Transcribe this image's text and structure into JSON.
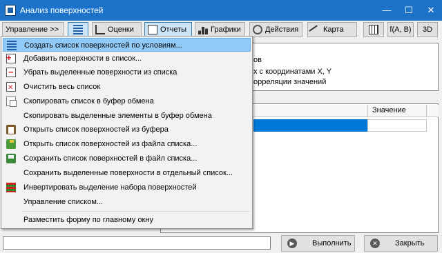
{
  "window": {
    "title": "Анализ поверхностей",
    "minimize": "—",
    "maximize": "☐",
    "close": "✕"
  },
  "toolbar": {
    "manage": "Управление >>",
    "grades": "Оценки",
    "reports": "Отчеты",
    "charts": "Графики",
    "actions": "Действия",
    "map": "Карта",
    "func": "f(A, B)",
    "three_d": "3D"
  },
  "info_panel": {
    "line1": "ов",
    "line2": "х с координатами X, Y",
    "line3": "орреляции значений"
  },
  "grid": {
    "value_header": "Значение"
  },
  "menu": {
    "items": [
      {
        "label": "Создать список поверхностей по условиям...",
        "icon": "list-conditions-icon"
      },
      {
        "label": "Добавить поверхности в список...",
        "icon": "add-to-list-icon"
      },
      {
        "label": "Убрать выделенные поверхности из списка",
        "icon": "remove-from-list-icon"
      },
      {
        "label": "Очистить весь список",
        "icon": "clear-list-icon"
      },
      {
        "label": "Скопировать список в буфер обмена",
        "icon": "copy-icon"
      },
      {
        "label": "Скопировать выделенные элементы в буфер обмена",
        "icon": ""
      },
      {
        "label": "Открыть список поверхностей из буфера",
        "icon": "clipboard-icon"
      },
      {
        "label": "Открыть список поверхностей из файла списка...",
        "icon": "open-file-icon"
      },
      {
        "label": "Сохранить список поверхностей в файл списка...",
        "icon": "save-file-icon"
      },
      {
        "label": "Сохранить выделенные поверхности в отдельный список...",
        "icon": ""
      },
      {
        "label": "Инвертировать выделение набора поверхностей",
        "icon": "invert-selection-icon"
      },
      {
        "label": "Управление списком...",
        "icon": ""
      },
      {
        "label": "Разместить форму по главному окну",
        "icon": ""
      }
    ]
  },
  "buttons": {
    "run": "Выполнить",
    "close": "Закрыть"
  }
}
